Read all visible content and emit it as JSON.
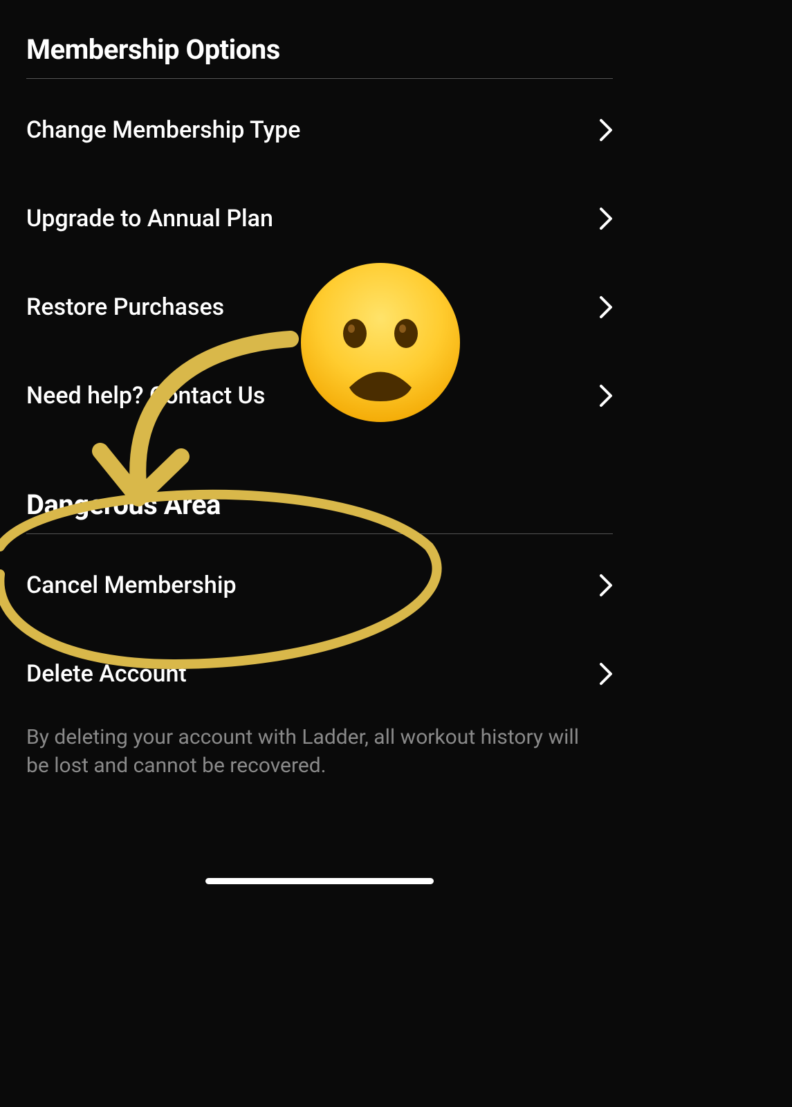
{
  "sections": {
    "membership": {
      "title": "Membership Options",
      "items": [
        {
          "label": "Change Membership Type"
        },
        {
          "label": "Upgrade to Annual Plan"
        },
        {
          "label": "Restore Purchases"
        },
        {
          "label": "Need help? Contact Us"
        }
      ]
    },
    "dangerous": {
      "title": "Dangerous Area",
      "items": [
        {
          "label": "Cancel Membership"
        },
        {
          "label": "Delete Account"
        }
      ],
      "footnote": "By deleting your account with Ladder, all workout history will be lost and cannot be recovered."
    }
  },
  "annotation": {
    "emoji": "frowning-face",
    "circle_target": "Dangerous Area / Cancel Membership",
    "arrow_color": "#d9b84a"
  }
}
